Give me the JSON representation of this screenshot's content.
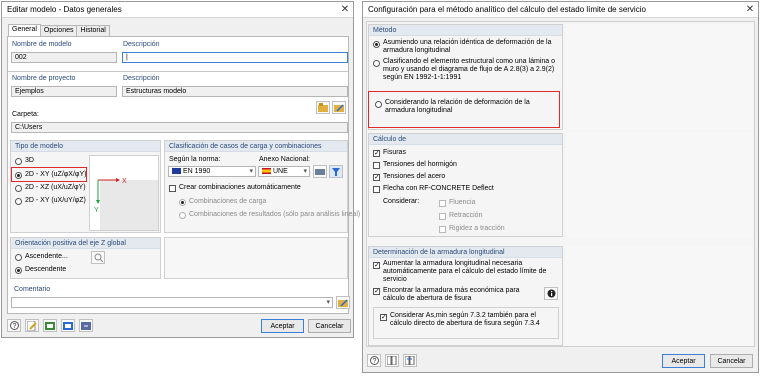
{
  "left": {
    "title": "Editar modelo - Datos generales",
    "tabs": [
      "General",
      "Opciones",
      "Historial"
    ],
    "model_name_label": "Nombre de modelo",
    "model_name": "002",
    "description_label": "Descripción",
    "description": "|",
    "project_name_label": "Nombre de proyecto",
    "project_name": "Ejemplos",
    "project_desc_label": "Descripción",
    "project_desc": "Estructuras modelo",
    "folder_label": "Carpeta:",
    "folder": "C:\\Users",
    "model_type_header": "Tipo de modelo",
    "model_types": [
      "3D",
      "2D - XY (uZ/φX/φY)",
      "2D - XZ (uX/uZ/φY)",
      "2D - XY (uX/uY/φZ)"
    ],
    "loadcase_header": "Clasificación de casos de carga y combinaciones",
    "norm_label": "Según la norma:",
    "norm_value": "EN 1990",
    "annex_label": "Anexo Nacional:",
    "annex_value": "UNE",
    "create_combos": "Crear combinaciones automáticamente",
    "combo_load": "Combinaciones de carga",
    "combo_results": "Combinaciones de resultados (sólo para análisis lineal)",
    "orientation_header": "Orientación positiva del eje Z global",
    "orientation_up": "Ascendente...",
    "orientation_down": "Descendente",
    "comment_header": "Comentario",
    "ok": "Aceptar",
    "cancel": "Cancelar",
    "diagram_axis_x": "X",
    "diagram_axis_y": "Y"
  },
  "right": {
    "title": "Configuración para el método analítico del cálculo del estado límite de servicio",
    "method_header": "Método",
    "method_options": [
      "Asumiendo una relación idéntica de deformación de la armadura longitudinal",
      "Clasificando el elemento estructural como una lámina o muro y usando el diagrama de flujo de A 2.8(3) a 2.9(2) según EN 1992-1-1:1991",
      "Considerando la relación de deformación de la armadura longitudinal"
    ],
    "calc_header": "Cálculo de",
    "calc_items": [
      "Fisuras",
      "Tensiones del hormigón",
      "Tensiones del acero",
      "Flecha con RF-CONCRETE Deflect"
    ],
    "consider_label": "Considerar:",
    "consider_items": [
      "Fluencia",
      "Retracción",
      "Rigidez a tracción"
    ],
    "reinf_header": "Determinación de la armadura longitudinal",
    "reinf_items": [
      "Aumentar la armadura longitudinal necesaria automáticamente para el cálculo del estado límite de servicio",
      "Encontrar la armadura más económica para cálculo de abertura de fisura",
      "Considerar As,min según 7.3.2 también para el cálculo directo de abertura de fisura según 7.3.4"
    ],
    "ok": "Aceptar",
    "cancel": "Cancelar"
  },
  "colors": {
    "accent": "#3c7fd8",
    "highlight": "#e0282f",
    "group_header": "#e4e9f0"
  }
}
